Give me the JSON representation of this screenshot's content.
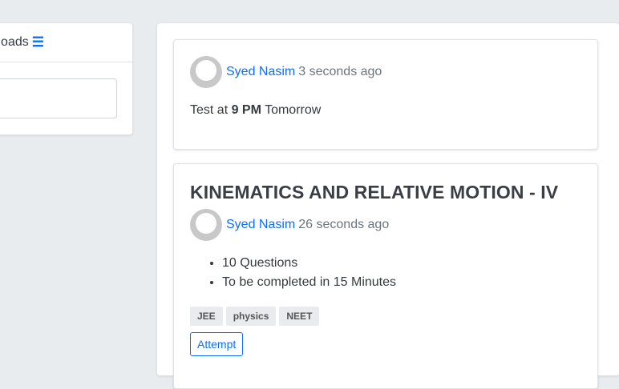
{
  "sidebar": {
    "header_text": "oads",
    "menu_icon": "bars-icon"
  },
  "posts": [
    {
      "author": "Syed Nasim",
      "time": "3 seconds ago",
      "body_prefix": "Test at ",
      "body_bold": "9 PM",
      "body_suffix": " Tomorrow"
    },
    {
      "title": "KINEMATICS AND RELATIVE MOTION - IV",
      "author": "Syed Nasim",
      "time": "26 seconds ago",
      "items": [
        "10 Questions",
        "To be completed in 15 Minutes"
      ],
      "tags": [
        "JEE",
        "physics",
        "NEET"
      ],
      "action_label": "Attempt"
    }
  ],
  "colors": {
    "link": "#0d6efd",
    "muted": "#6c757d",
    "background": "#e9ecef"
  }
}
